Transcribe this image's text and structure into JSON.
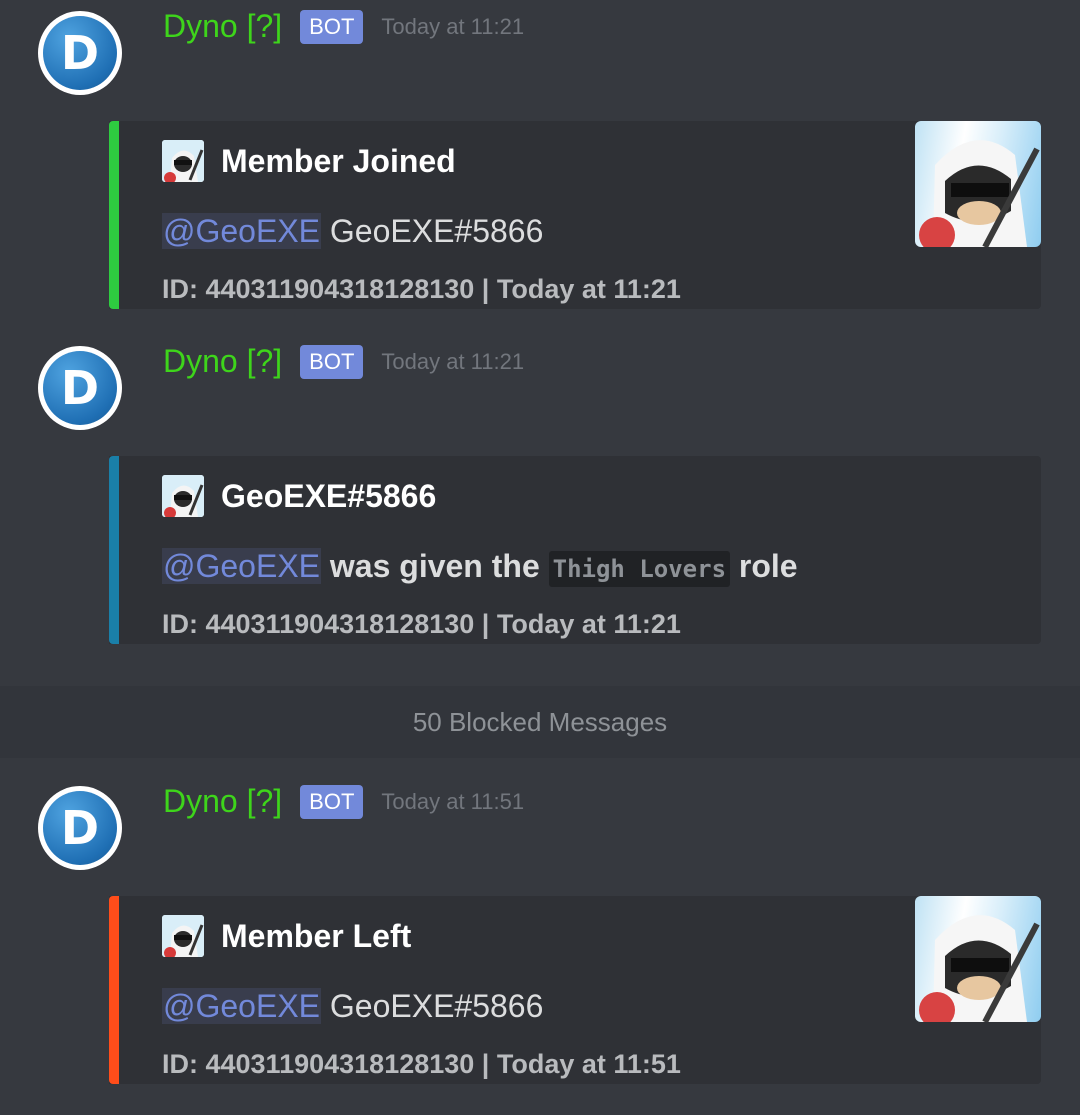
{
  "messages": [
    {
      "author": "Dyno [?]",
      "bot_tag": "BOT",
      "timestamp": "Today at 11:21",
      "avatar_letter": "D",
      "embed": {
        "color": "#2ecc40",
        "author_name": "Member Joined",
        "mention": "@GeoEXE",
        "text": "GeoEXE#5866",
        "footer": "ID: 440311904318128130 | Today at 11:21",
        "has_thumbnail": true
      }
    },
    {
      "author": "Dyno [?]",
      "bot_tag": "BOT",
      "timestamp": "Today at 11:21",
      "avatar_letter": "D",
      "embed": {
        "color": "#1a7fa8",
        "author_name": "GeoEXE#5866",
        "mention": "@GeoEXE",
        "text_before": "was given the",
        "role": "Thigh Lovers",
        "text_after": "role",
        "footer": "ID: 440311904318128130 | Today at 11:21",
        "has_thumbnail": false
      }
    },
    {
      "author": "Dyno [?]",
      "bot_tag": "BOT",
      "timestamp": "Today at 11:51",
      "avatar_letter": "D",
      "embed": {
        "color": "#ff4d1a",
        "author_name": "Member Left",
        "mention": "@GeoEXE",
        "text": "GeoEXE#5866",
        "footer": "ID: 440311904318128130 | Today at 11:51",
        "has_thumbnail": true
      }
    }
  ],
  "blocked_messages": "50 Blocked Messages"
}
